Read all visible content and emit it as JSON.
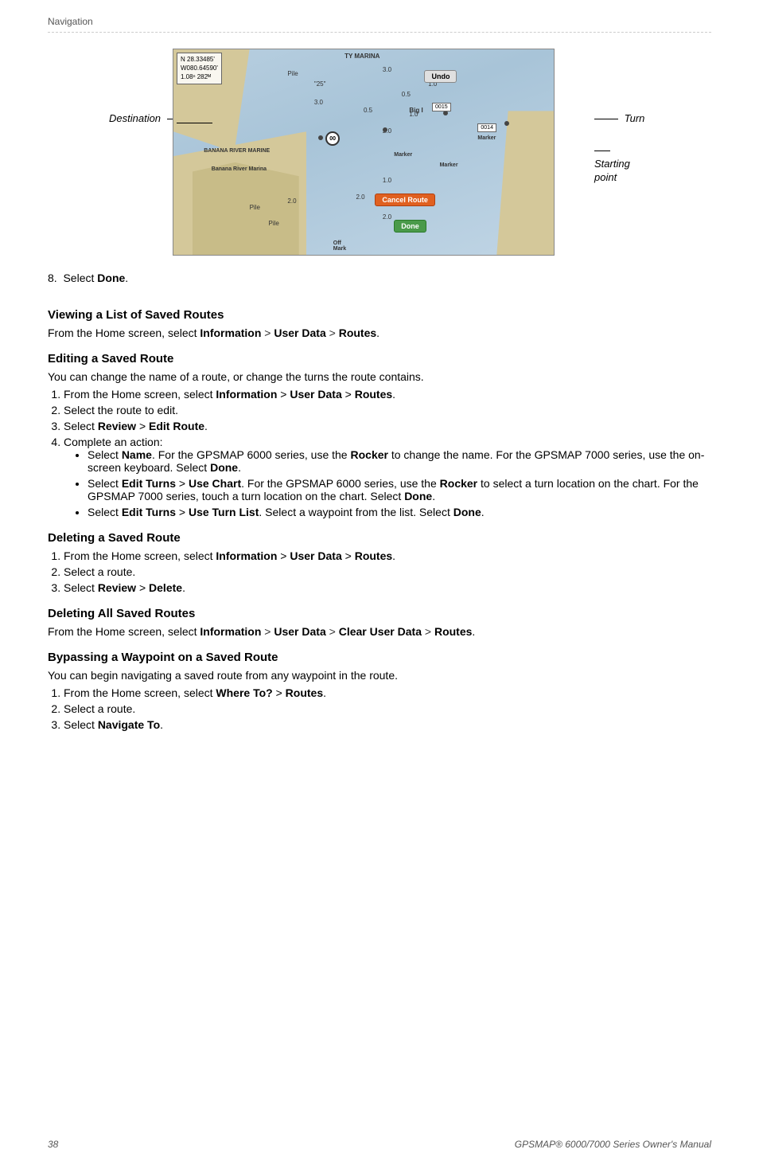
{
  "header": {
    "title": "Navigation"
  },
  "figure": {
    "destination_label": "Destination",
    "turn_label": "Turn",
    "starting_point_label": "Starting\npoint",
    "coord_line1": "N  28.33485'",
    "coord_line2": "W080.64590'",
    "coord_line3": "1.08ⁿ  282ᴹ",
    "marina_label": "TY MARINA",
    "banana_marina_label": "BANANA RIVER MARINE",
    "undo_btn": "Undo",
    "cancel_route_btn": "Cancel Route",
    "done_btn": "Done"
  },
  "step8": {
    "text": "Select ",
    "link": "Done",
    "suffix": "."
  },
  "section_viewing": {
    "heading": "Viewing a List of Saved Routes",
    "text": "From the Home screen, select ",
    "link1": "Information",
    "sep1": " > ",
    "link2": "User Data",
    "sep2": " > ",
    "link3": "Routes",
    "suffix": "."
  },
  "section_editing": {
    "heading": "Editing a Saved Route",
    "intro": "You can change the name of a route, or change the turns the route contains.",
    "steps": [
      {
        "text": "From the Home screen, select ",
        "link1": "Information",
        "sep1": " > ",
        "link2": "User Data",
        "sep2": " > ",
        "link3": "Routes",
        "suffix": "."
      },
      {
        "text": "Select the route to edit."
      },
      {
        "text": "Select ",
        "link1": "Review",
        "sep1": " > ",
        "link2": "Edit Route",
        "suffix": "."
      },
      {
        "text": "Complete an action:"
      }
    ],
    "bullets": [
      {
        "text": "Select ",
        "link1": "Name",
        "mid1": ". For the GPSMAP 6000 series, use the ",
        "link2": "Rocker",
        "mid2": " to change the name. For the GPSMAP 7000 series, use the on-screen keyboard. Select ",
        "link3": "Done",
        "suffix": "."
      },
      {
        "text": "Select ",
        "link1": "Edit Turns",
        "sep1": " > ",
        "link2": "Use Chart",
        "mid1": ". For the GPSMAP 6000 series, use the ",
        "link3": "Rocker",
        "mid2": " to select a turn location on the chart. For the GPSMAP 7000 series, touch a turn location on the chart. Select ",
        "link4": "Done",
        "suffix": "."
      },
      {
        "text": "Select ",
        "link1": "Edit Turns",
        "sep1": " > ",
        "link2": "Use Turn List",
        "mid1": ". Select a waypoint from the list. Select ",
        "link3": "Done",
        "suffix": "."
      }
    ]
  },
  "section_deleting": {
    "heading": "Deleting a Saved Route",
    "steps": [
      {
        "text": "From the Home screen, select ",
        "link1": "Information",
        "sep1": " > ",
        "link2": "User Data",
        "sep2": " > ",
        "link3": "Routes",
        "suffix": "."
      },
      {
        "text": "Select a route."
      },
      {
        "text": "Select ",
        "link1": "Review",
        "sep1": " > ",
        "link2": "Delete",
        "suffix": "."
      }
    ]
  },
  "section_deleting_all": {
    "heading": "Deleting All Saved Routes",
    "text": "From the Home screen, select ",
    "link1": "Information",
    "sep1": " > ",
    "link2": "User Data",
    "sep2": " > ",
    "link3": "Clear User Data",
    "sep3": " > ",
    "link4": "Routes",
    "suffix": "."
  },
  "section_bypassing": {
    "heading": "Bypassing a Waypoint on a Saved Route",
    "intro": "You can begin navigating a saved route from any waypoint in the route.",
    "steps": [
      {
        "text": "From the Home screen, select ",
        "link1": "Where To?",
        "sep1": " > ",
        "link2": "Routes",
        "suffix": "."
      },
      {
        "text": "Select a route."
      },
      {
        "text": "Select ",
        "link1": "Navigate To",
        "suffix": "."
      }
    ]
  },
  "footer": {
    "page_number": "38",
    "manual_title": "GPSMAP® 6000/7000 Series Owner's Manual"
  }
}
